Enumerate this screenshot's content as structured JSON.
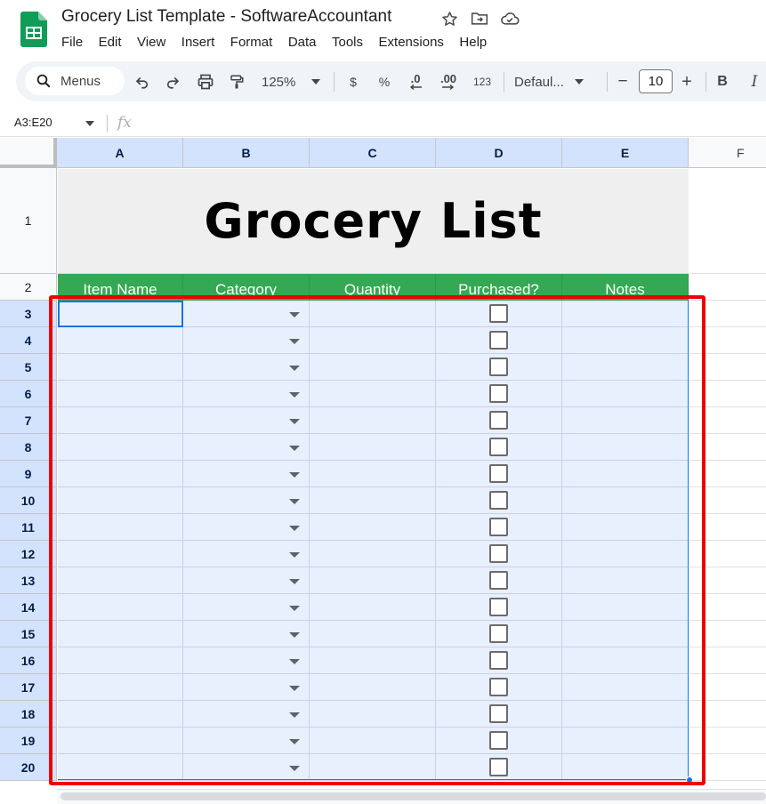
{
  "app": {
    "doc_title": "Grocery List Template - SoftwareAccountant",
    "brand_color": "#0f9d58",
    "menu": [
      "File",
      "Edit",
      "View",
      "Insert",
      "Format",
      "Data",
      "Tools",
      "Extensions",
      "Help"
    ]
  },
  "toolbar": {
    "search_label": "Menus",
    "zoom": "125%",
    "currency": "$",
    "percent": "%",
    "decrease_decimal": ".0",
    "increase_decimal": ".00",
    "number_format": "123",
    "font": "Defaul...",
    "font_size": "10",
    "bold": "B",
    "italic": "I",
    "minus": "−",
    "plus": "+"
  },
  "formula_bar": {
    "namebox": "A3:E20",
    "fx": "fx",
    "value": ""
  },
  "columns": [
    "A",
    "B",
    "C",
    "D",
    "E",
    "F"
  ],
  "sheet": {
    "title": "Grocery List",
    "headers": [
      "Item Name",
      "Category",
      "Quantity",
      "Purchased?",
      "Notes"
    ],
    "header_color": "#34a853",
    "selection_color": "#e8f0fe",
    "highlight_color": "#ee0000",
    "row_numbers": [
      "1",
      "2",
      "3",
      "4",
      "5",
      "6",
      "7",
      "8",
      "9",
      "10",
      "11",
      "12",
      "13",
      "14",
      "15",
      "16",
      "17",
      "18",
      "19",
      "20"
    ]
  }
}
